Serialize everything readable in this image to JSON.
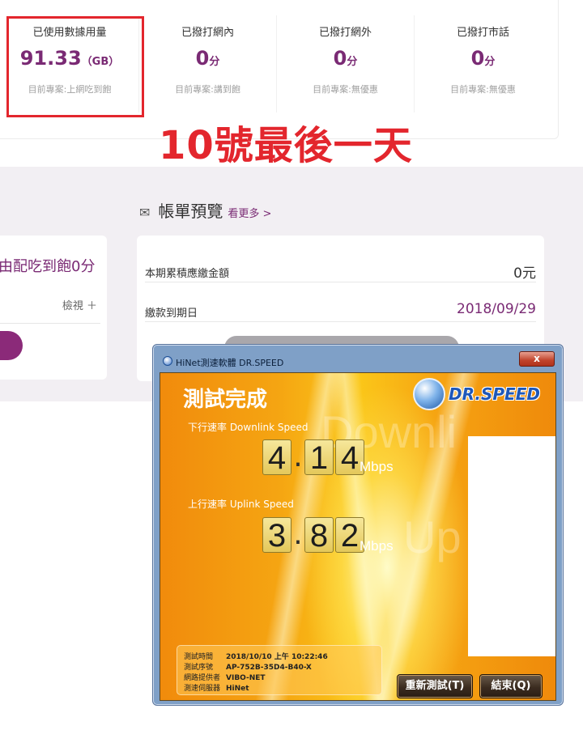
{
  "usage_stats": [
    {
      "title": "已使用數據用量",
      "value": "91.33",
      "unit": "（GB）",
      "plan": "目前專案:上網吃到飽"
    },
    {
      "title": "已撥打網內",
      "value": "0",
      "unit": "分",
      "plan": "目前專案:講到飽"
    },
    {
      "title": "已撥打網外",
      "value": "0",
      "unit": "分",
      "plan": "目前專案:無優惠"
    },
    {
      "title": "已撥打市話",
      "value": "0",
      "unit": "分",
      "plan": "目前專案:無優惠"
    }
  ],
  "annotation": "10號最後一天",
  "left_card": {
    "promo": "由配吃到飽0分",
    "view_label": "檢視 ＋"
  },
  "bill": {
    "title": "帳單預覽",
    "more": "看更多 >",
    "rows": [
      {
        "label": "本期累積應繳金額",
        "value": "0元"
      },
      {
        "label": "繳款到期日",
        "value": "2018/09/29"
      }
    ]
  },
  "speed_window": {
    "title": "HiNet測速軟體 DR.SPEED",
    "close": "x",
    "heading": "測試完成",
    "brand": "DR.SPEED",
    "bg_text_1": "Downli",
    "bg_text_2": "Up",
    "downlink_label": "下行速率 Downlink  Speed",
    "downlink": {
      "d1": "4",
      "dot": ".",
      "d2": "1",
      "d3": "4",
      "unit": "Mbps",
      "value": "4.14"
    },
    "uplink_label": "上行速率 Uplink Speed",
    "uplink": {
      "d1": "3",
      "dot": ".",
      "d2": "8",
      "d3": "2",
      "unit": "Mbps",
      "value": "3.82"
    },
    "info": [
      {
        "key": "測試時間",
        "value": "2018/10/10 上午 10:22:46"
      },
      {
        "key": "測試序號",
        "value": "AP-752B-35D4-B40-X"
      },
      {
        "key": "網路提供者",
        "value": "VIBO-NET"
      },
      {
        "key": "測速伺服器",
        "value": "HiNet"
      }
    ],
    "retest_label": "重新測試(T)",
    "end_label": "結束(Q)"
  },
  "colors": {
    "accent": "#7a2a74",
    "annotation_red": "#e3262d",
    "band": "#f2eff3"
  }
}
